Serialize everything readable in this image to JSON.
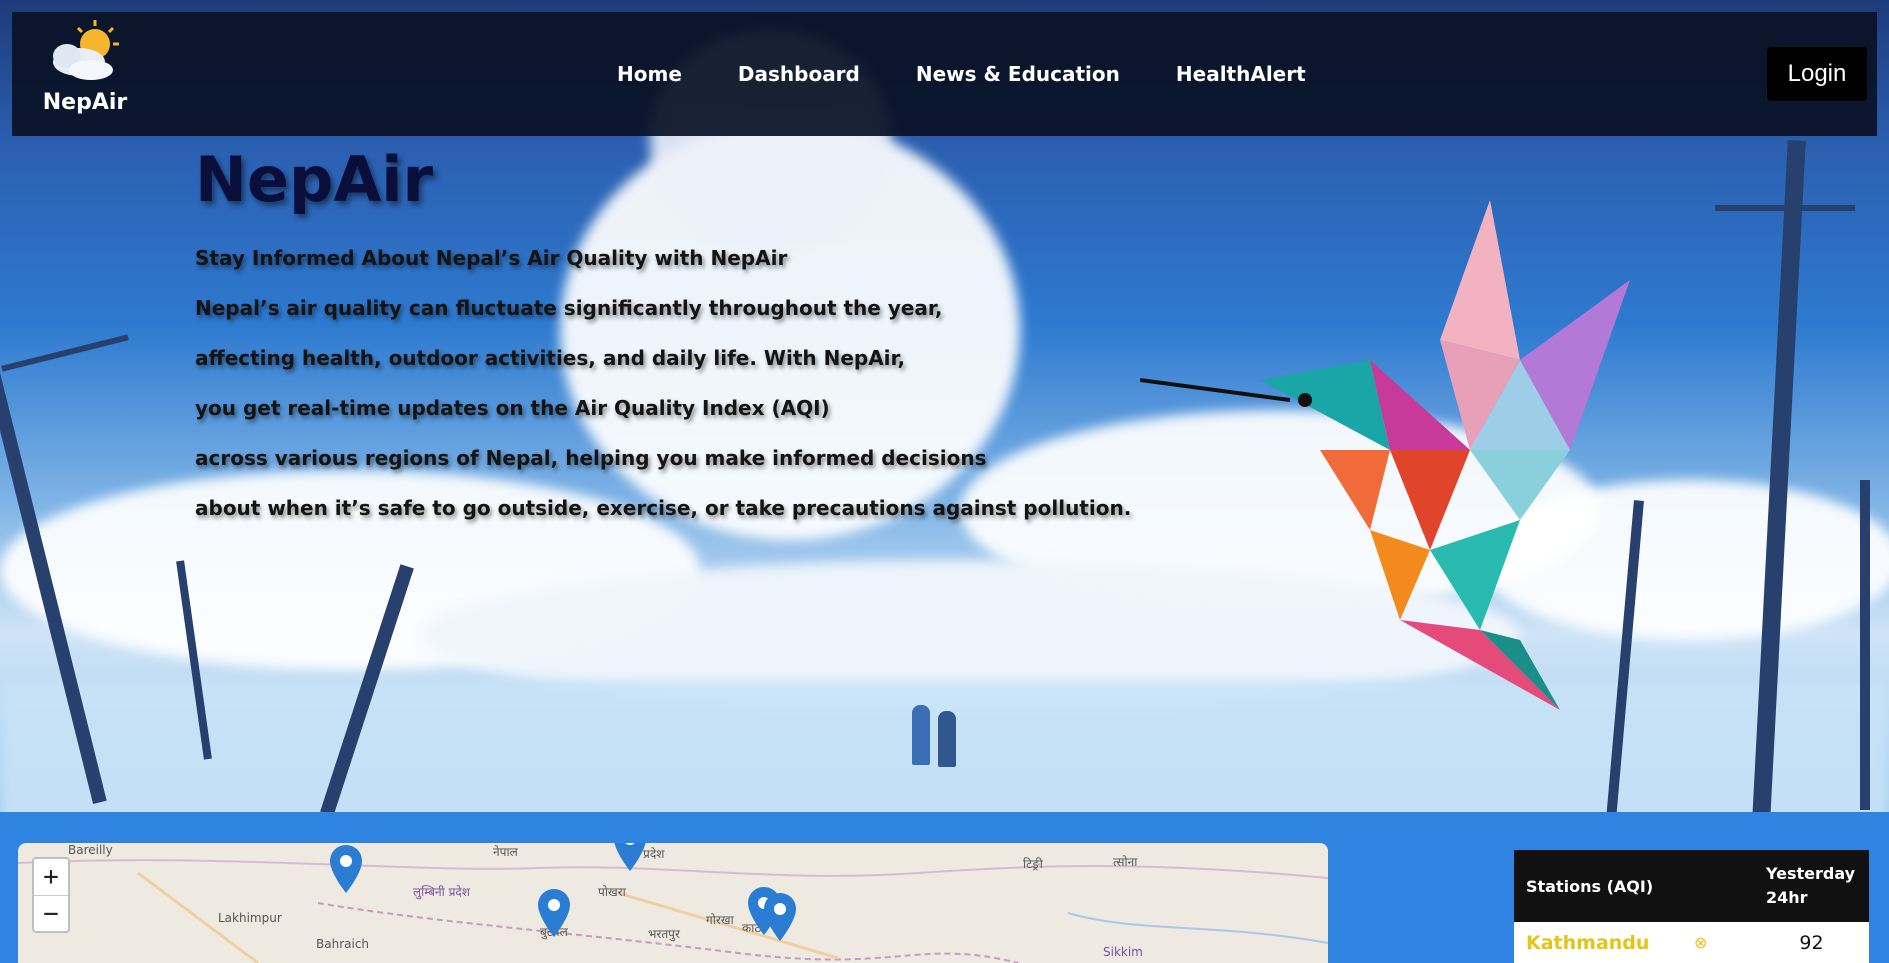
{
  "brand": {
    "name": "NepAir",
    "logo_icon": "cloud-sun-icon"
  },
  "nav": {
    "items": [
      {
        "label": "Home"
      },
      {
        "label": "Dashboard"
      },
      {
        "label": "News & Education"
      },
      {
        "label": "HealthAlert"
      }
    ],
    "login_label": "Login"
  },
  "hero": {
    "title": "NepAir",
    "lines": [
      "Stay Informed About Nepal’s Air Quality with NepAir",
      "Nepal’s air quality can fluctuate significantly throughout the year,",
      "affecting health, outdoor activities, and daily life. With NepAir,",
      "you get real-time updates on the Air Quality Index (AQI)",
      "across various regions of Nepal, helping you make informed decisions",
      "about when it’s safe to go outside, exercise, or take precautions against pollution."
    ]
  },
  "map": {
    "zoom_in": "+",
    "zoom_out": "−",
    "labels": [
      "Bareilly",
      "नेपाल",
      "प्रदेश",
      "लुम्बिनी प्रदेश",
      "पोखरा",
      "Lakhimpur",
      "Bahraich",
      "बुटवल",
      "भरतपुर",
      "गोरखा",
      "काठ",
      "टिङ्री",
      "त्सोना",
      "Sikkim"
    ]
  },
  "stations": {
    "header_name": "Stations (AQI)",
    "header_yesterday": "Yesterday 24hr",
    "rows": [
      {
        "name": "Kathmandu",
        "value": "92",
        "status_icon": "circle-x-icon"
      }
    ]
  },
  "colors": {
    "nav_bg": "#0a1226",
    "bottom_bg": "#2f84e2",
    "station_text": "#e3c419",
    "marker": "#2a7dd2"
  }
}
